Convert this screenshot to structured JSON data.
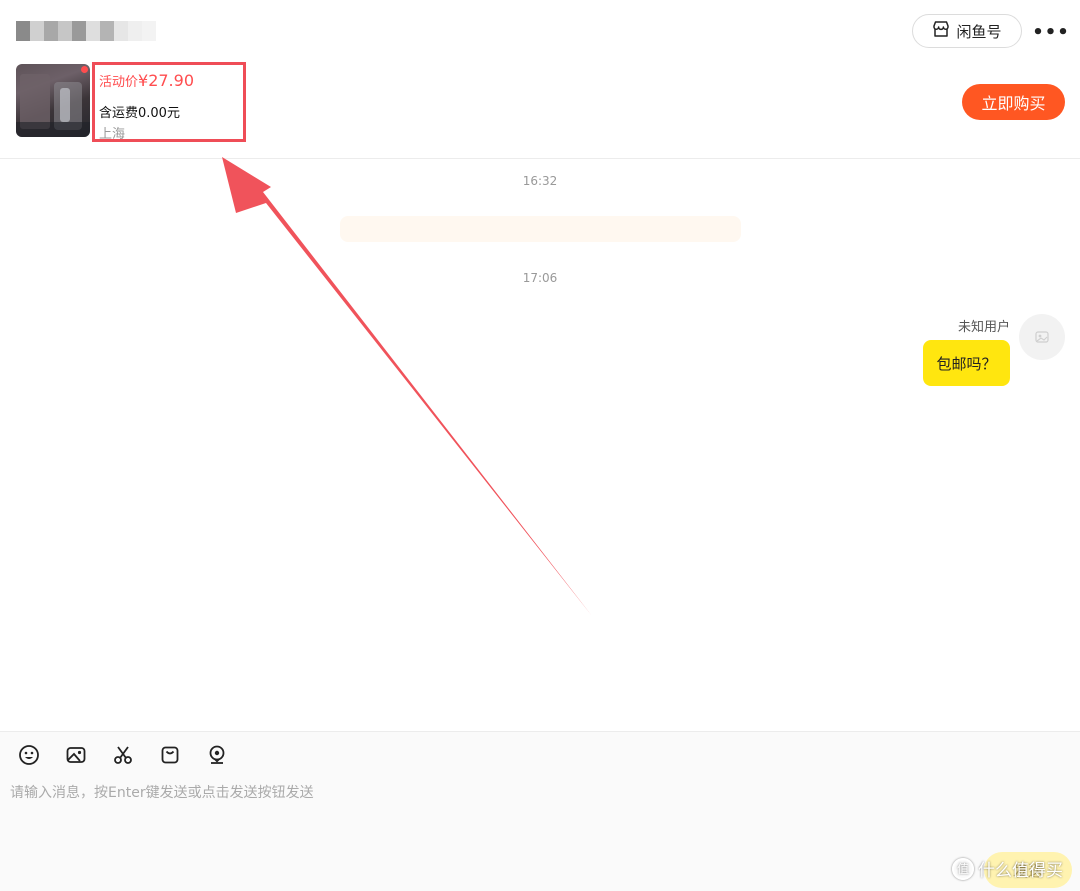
{
  "header": {
    "contact_name": "",
    "xianyu_button": "闲鱼号",
    "more_label": "•••"
  },
  "product": {
    "price_prefix": "活动价",
    "price": "¥27.90",
    "shipping": "含运费0.00元",
    "location": "上海",
    "buy_button": "立即购买"
  },
  "messages": {
    "timestamp_1": "16:32",
    "timestamp_2": "17:06",
    "sender_name": "未知用户",
    "bubble_text": "包邮吗？"
  },
  "composer": {
    "placeholder": "请输入消息，按Enter键发送或点击发送按钮发送",
    "send_button": "发送",
    "toolbar_icons": [
      "emoji-icon",
      "image-icon",
      "scissors-icon",
      "bag-icon",
      "location-icon"
    ]
  },
  "watermark": {
    "logo_char": "值",
    "text": "什么值得买"
  },
  "colors": {
    "accent": "#ff5722",
    "bubble": "#ffe60f",
    "highlight_box": "#ef4d57",
    "price": "#ff4d4f"
  }
}
